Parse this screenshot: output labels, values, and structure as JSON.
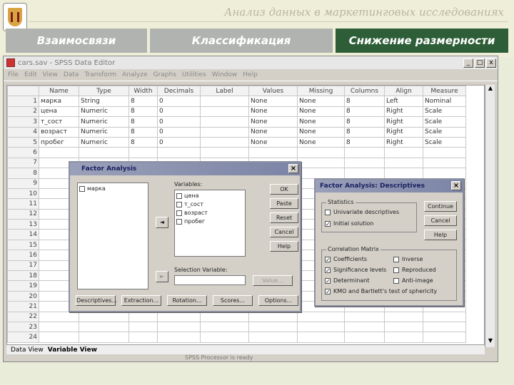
{
  "slide": {
    "title": "Анализ данных в маркетинговых исследованиях",
    "tabs": [
      "Взаимосвязи",
      "Классификация",
      "Снижение размерности"
    ]
  },
  "window": {
    "title": "cars.sav - SPSS Data Editor",
    "menu": [
      "File",
      "Edit",
      "View",
      "Data",
      "Transform",
      "Analyze",
      "Graphs",
      "Utilities",
      "Window",
      "Help"
    ],
    "controls": [
      "_",
      "□",
      "x"
    ]
  },
  "grid": {
    "columns": [
      "Name",
      "Type",
      "Width",
      "Decimals",
      "Label",
      "Values",
      "Missing",
      "Columns",
      "Align",
      "Measure"
    ],
    "rows": [
      [
        "1",
        "марка",
        "String",
        "8",
        "0",
        "",
        "None",
        "None",
        "8",
        "Left",
        "Nominal"
      ],
      [
        "2",
        "цена",
        "Numeric",
        "8",
        "0",
        "",
        "None",
        "None",
        "8",
        "Right",
        "Scale"
      ],
      [
        "3",
        "т_сост",
        "Numeric",
        "8",
        "0",
        "",
        "None",
        "None",
        "8",
        "Right",
        "Scale"
      ],
      [
        "4",
        "возраст",
        "Numeric",
        "8",
        "0",
        "",
        "None",
        "None",
        "8",
        "Right",
        "Scale"
      ],
      [
        "5",
        "пробег",
        "Numeric",
        "8",
        "0",
        "",
        "None",
        "None",
        "8",
        "Right",
        "Scale"
      ]
    ],
    "empty_row_numbers": [
      "6",
      "7",
      "8",
      "9",
      "10",
      "11",
      "12",
      "13",
      "14",
      "15",
      "16",
      "17",
      "18",
      "19",
      "20",
      "21",
      "22",
      "23",
      "24"
    ]
  },
  "sheet_tabs": {
    "data_view": "Data View",
    "variable_view": "Variable View"
  },
  "status": "SPSS Processor is ready",
  "factor_dialog": {
    "title": "Factor Analysis",
    "source_list": [
      "марка"
    ],
    "variables_label": "Variables:",
    "variables": [
      "цена",
      "т_сост",
      "возраст",
      "пробег"
    ],
    "selection_label": "Selection Variable:",
    "value_button": "Value...",
    "move_arrow": "◄",
    "move_arrow_2": "►",
    "side_buttons": [
      "OK",
      "Paste",
      "Reset",
      "Cancel",
      "Help"
    ],
    "bottom_buttons": [
      "Descriptives...",
      "Extraction...",
      "Rotation...",
      "Scores...",
      "Options..."
    ]
  },
  "descriptives_dialog": {
    "title": "Factor Analysis: Descriptives",
    "statistics_group": "Statistics",
    "statistics": [
      {
        "label": "Univariate descriptives",
        "checked": false
      },
      {
        "label": "Initial solution",
        "checked": true
      }
    ],
    "correlation_group": "Correlation Matrix",
    "correlation_left": [
      {
        "label": "Coefficients",
        "checked": true
      },
      {
        "label": "Significance levels",
        "checked": true
      },
      {
        "label": "Determinant",
        "checked": true
      },
      {
        "label": "KMO and Bartlett's test of sphericity",
        "checked": true
      }
    ],
    "correlation_right": [
      {
        "label": "Inverse",
        "checked": false
      },
      {
        "label": "Reproduced",
        "checked": false
      },
      {
        "label": "Anti-image",
        "checked": false
      }
    ],
    "buttons": [
      "Continue",
      "Cancel",
      "Help"
    ],
    "checkmark": "✓"
  }
}
